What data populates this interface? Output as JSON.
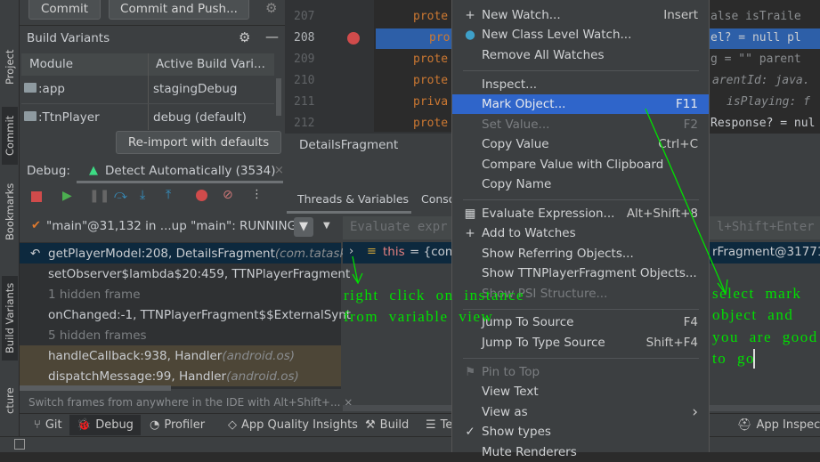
{
  "left_strip": {
    "items": [
      "Project",
      "Commit",
      "Bookmarks",
      "Build Variants",
      "cture"
    ]
  },
  "commit_panel": {
    "commit": "Commit",
    "commit_push": "Commit and Push..."
  },
  "build_variants": {
    "title": "Build Variants",
    "columns": [
      "Module",
      "Active Build Vari..."
    ],
    "rows": [
      {
        "module": ":app",
        "variant": "stagingDebug"
      },
      {
        "module": ":TtnPlayer",
        "variant": "debug (default)"
      }
    ],
    "reimport": "Re-import with defaults"
  },
  "editor": {
    "lines": [
      {
        "n": "207",
        "code": "prote"
      },
      {
        "n": "208",
        "code": "pro"
      },
      {
        "n": "209",
        "code": "prote"
      },
      {
        "n": "210",
        "code": "prote"
      },
      {
        "n": "211",
        "code": "priva"
      },
      {
        "n": "212",
        "code": "prote"
      }
    ],
    "right_fragments": [
      "alse  isTraile",
      "el? = null  pl",
      "g = \"\"  parent",
      "arentId: java.",
      "isPlaying: f",
      "Response? = nul"
    ],
    "breadcrumb": "DetailsFragment"
  },
  "debug": {
    "label": "Debug:",
    "session": "Detect Automatically (3534)",
    "tabs": [
      "Threads & Variables",
      "Conso"
    ],
    "thread": "\"main\"@31,132 in ...up \"main\": RUNNING",
    "evaluate_placeholder": "Evaluate expr",
    "evaluate_hint": "l+Shift+Enter",
    "frames": [
      {
        "text": "getPlayerModel:208, DetailsFragment ",
        "pkg": "(com.tatask",
        "kind": "selected"
      },
      {
        "text": "setObserver$lambda$20:459, TTNPlayerFragment",
        "pkg": "",
        "kind": "normal"
      },
      {
        "text": "1 hidden frame",
        "pkg": "",
        "kind": "hidden"
      },
      {
        "text": "onChanged:-1, TTNPlayerFragment$$ExternalSynt",
        "pkg": "",
        "kind": "normal"
      },
      {
        "text": "5 hidden frames",
        "pkg": "",
        "kind": "hidden"
      },
      {
        "text": "handleCallback:938, Handler ",
        "pkg": "(android.os)",
        "kind": "lib"
      },
      {
        "text": "dispatchMessage:99, Handler ",
        "pkg": "(android.os)",
        "kind": "lib"
      }
    ],
    "variable": {
      "name": "this",
      "value": "= {com.",
      "tail": "rFragment@31771"
    },
    "hint": "Switch frames from anywhere in the IDE with Alt+Shift+... ×"
  },
  "bottom_tabs": [
    "Git",
    "Debug",
    "Profiler",
    "App Quality Insights",
    "Build",
    "Te",
    "App Inspectio"
  ],
  "context_menu": {
    "items": [
      {
        "label": "New Watch...",
        "shortcut": "Insert",
        "icon": "plus-icon"
      },
      {
        "label": "New Class Level Watch...",
        "shortcut": "",
        "icon": "class-watch-icon"
      },
      {
        "label": "Remove All Watches",
        "shortcut": ""
      },
      {
        "label": "Inspect...",
        "shortcut": ""
      },
      {
        "label": "Mark Object...",
        "shortcut": "F11",
        "selected": true
      },
      {
        "label": "Set Value...",
        "shortcut": "F2",
        "disabled": true
      },
      {
        "label": "Copy Value",
        "shortcut": "Ctrl+C"
      },
      {
        "label": "Compare Value with Clipboard",
        "shortcut": ""
      },
      {
        "label": "Copy Name",
        "shortcut": ""
      },
      {
        "label": "Evaluate Expression...",
        "shortcut": "Alt+Shift+8",
        "icon": "calculator-icon"
      },
      {
        "label": "Add to Watches",
        "shortcut": "",
        "icon": "add-watch-icon"
      },
      {
        "label": "Show Referring Objects...",
        "shortcut": ""
      },
      {
        "label": "Show TTNPlayerFragment Objects...",
        "shortcut": ""
      },
      {
        "label": "Show PSI Structure...",
        "shortcut": "",
        "disabled": true
      },
      {
        "label": "Jump To Source",
        "shortcut": "F4"
      },
      {
        "label": "Jump To Type Source",
        "shortcut": "Shift+F4"
      },
      {
        "label": "Pin to Top",
        "shortcut": "",
        "disabled": true,
        "icon": "flag-icon"
      },
      {
        "label": "View Text",
        "shortcut": ""
      },
      {
        "label": "View as",
        "shortcut": "›"
      },
      {
        "label": "Show types",
        "shortcut": "",
        "icon": "check-icon"
      },
      {
        "label": "Mute Renderers",
        "shortcut": ""
      }
    ]
  },
  "annotations": {
    "left": [
      "right click on instance",
      "from variable view"
    ],
    "right": [
      "select mark",
      "object and",
      "you are good",
      "to go"
    ],
    "color": "#00e000"
  }
}
